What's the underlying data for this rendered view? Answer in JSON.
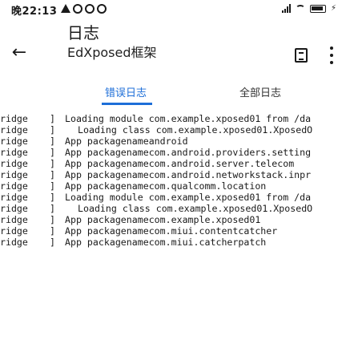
{
  "status_bar": {
    "time": "晚22:13",
    "icons": [
      "notification-icon",
      "app-icon",
      "app-icon",
      "app-icon"
    ],
    "signal": "signal-icon",
    "wifi": "wifi-icon",
    "battery": "battery-charging-icon"
  },
  "header": {
    "title": "日志",
    "subtitle": "EdXposed框架",
    "back_icon": "←",
    "actions": [
      "save-log-icon",
      "more-options-icon"
    ]
  },
  "tabs": [
    {
      "label": "错误日志",
      "active": true
    },
    {
      "label": "全部日志",
      "active": false
    }
  ],
  "log": {
    "rows": [
      {
        "tag": "Bridge",
        "msg": "Loading module com.example.xposed01 from /da",
        "indent": false
      },
      {
        "tag": "Bridge",
        "msg": "Loading class com.example.xposed01.XposedO",
        "indent": true
      },
      {
        "tag": "Bridge",
        "msg": "App packagenameandroid",
        "indent": false
      },
      {
        "tag": "Bridge",
        "msg": "App packagenamecom.android.providers.setting",
        "indent": false
      },
      {
        "tag": "Bridge",
        "msg": "App packagenamecom.android.server.telecom",
        "indent": false
      },
      {
        "tag": "Bridge",
        "msg": "App packagenamecom.android.networkstack.inpr",
        "indent": false
      },
      {
        "tag": "Bridge",
        "msg": "App packagenamecom.qualcomm.location",
        "indent": false
      },
      {
        "tag": "Bridge",
        "msg": "Loading module com.example.xposed01 from /da",
        "indent": false
      },
      {
        "tag": "Bridge",
        "msg": "Loading class com.example.xposed01.XposedO",
        "indent": true
      },
      {
        "tag": "Bridge",
        "msg": "App packagenamecom.example.xposed01",
        "indent": false
      },
      {
        "tag": "Bridge",
        "msg": "App packagenamecom.miui.contentcatcher",
        "indent": false
      },
      {
        "tag": "Bridge",
        "msg": "App packagenamecom.miui.catcherpatch",
        "indent": false
      }
    ]
  },
  "colors": {
    "accent": "#1d6ed8",
    "text": "#1a1a1a",
    "background": "#ffffff"
  }
}
